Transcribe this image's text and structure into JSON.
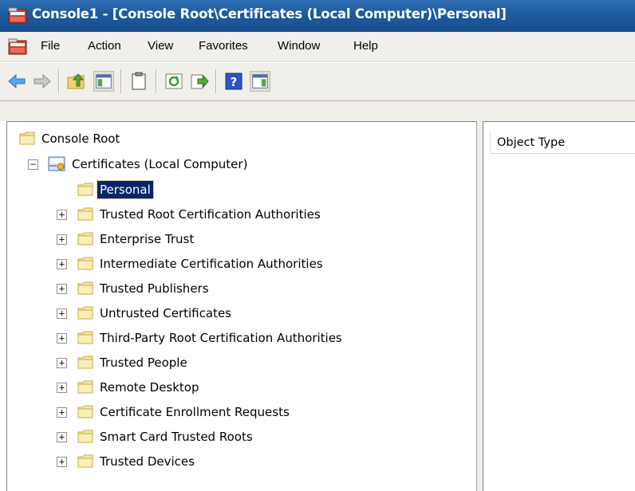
{
  "window": {
    "title": "Console1 - [Console Root\\Certificates (Local Computer)\\Personal]",
    "icon": "mmc-console-icon"
  },
  "menubar": {
    "items": [
      "File",
      "Action",
      "View",
      "Favorites",
      "Window",
      "Help"
    ]
  },
  "toolbar": {
    "buttons": [
      "back-icon",
      "forward-icon",
      "up-folder-icon",
      "show-hide-tree-icon",
      "properties-icon",
      "refresh-icon",
      "export-list-icon",
      "help-icon",
      "show-action-pane-icon"
    ]
  },
  "tree": {
    "root": "Console Root",
    "snapin": "Certificates (Local Computer)",
    "snapin_expander": "−",
    "items": [
      {
        "label": "Personal",
        "selected": true,
        "expander": ""
      },
      {
        "label": "Trusted Root Certification Authorities",
        "expander": "+"
      },
      {
        "label": "Enterprise Trust",
        "expander": "+"
      },
      {
        "label": "Intermediate Certification Authorities",
        "expander": "+"
      },
      {
        "label": "Trusted Publishers",
        "expander": "+"
      },
      {
        "label": "Untrusted Certificates",
        "expander": "+"
      },
      {
        "label": "Third-Party Root Certification Authorities",
        "expander": "+"
      },
      {
        "label": "Trusted People",
        "expander": "+"
      },
      {
        "label": "Remote Desktop",
        "expander": "+"
      },
      {
        "label": "Certificate Enrollment Requests",
        "expander": "+"
      },
      {
        "label": "Smart Card Trusted Roots",
        "expander": "+"
      },
      {
        "label": "Trusted Devices",
        "expander": "+"
      }
    ]
  },
  "list": {
    "columns": [
      "Object Type"
    ]
  },
  "colors": {
    "titlebar": "#1d5a9e",
    "selection": "#0a246a",
    "chrome": "#f0efe9"
  }
}
